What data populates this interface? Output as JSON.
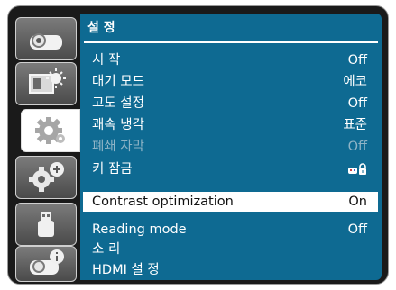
{
  "menu": {
    "title": "설 정",
    "items": [
      {
        "label": "시 작",
        "value": "Off"
      },
      {
        "label": "대기 모드",
        "value": "에코"
      },
      {
        "label": "고도 설정",
        "value": "Off"
      },
      {
        "label": "쾌속 냉각",
        "value": "표준"
      },
      {
        "label": "폐쇄 자막",
        "value": "Off"
      },
      {
        "label": "키 잠금",
        "value": "lock-icon"
      },
      {
        "label": "Contrast optimization",
        "value": "On"
      },
      {
        "label": "Reading mode",
        "value": "Off"
      },
      {
        "label": "소 리",
        "value": ""
      },
      {
        "label": "HDMI 설 정",
        "value": ""
      }
    ],
    "selected_index": 6,
    "disabled_index": 4
  },
  "sidebar": {
    "items": [
      {
        "icon": "projector-icon"
      },
      {
        "icon": "picture-adjust-icon"
      },
      {
        "icon": "setting-gear-icon"
      },
      {
        "icon": "expanded-gear-icon"
      },
      {
        "icon": "usb-icon"
      },
      {
        "icon": "info-icon"
      }
    ],
    "active_index": 2
  },
  "colors": {
    "panel": "#0e6a92",
    "frame": "#1a1a1a",
    "selected_bg": "#ffffff",
    "disabled_text": "#8fb4c6"
  }
}
